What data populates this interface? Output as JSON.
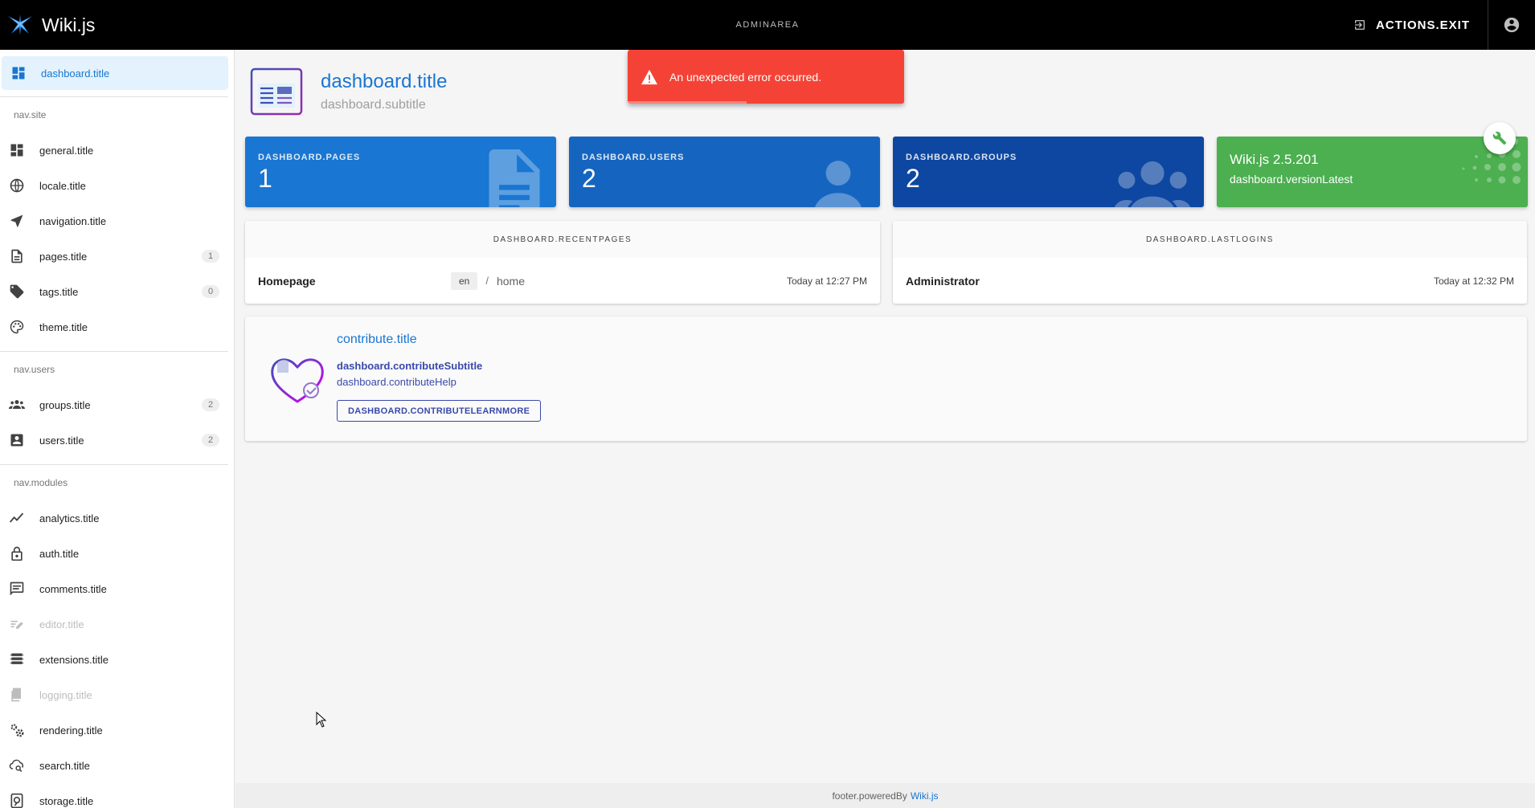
{
  "topbar": {
    "brand": "Wiki.js",
    "center_label": "ADMINAREA",
    "exit_label": "ACTIONS.EXIT"
  },
  "sidebar": {
    "dashboard": "dashboard.title",
    "site_header": "nav.site",
    "site_items": [
      {
        "label": "general.title",
        "icon": "dashboard-grid-icon"
      },
      {
        "label": "locale.title",
        "icon": "globe-icon"
      },
      {
        "label": "navigation.title",
        "icon": "navigation-arrow-icon"
      },
      {
        "label": "pages.title",
        "icon": "page-icon",
        "count": "1"
      },
      {
        "label": "tags.title",
        "icon": "tags-icon",
        "count": "0"
      },
      {
        "label": "theme.title",
        "icon": "palette-icon"
      }
    ],
    "users_header": "nav.users",
    "user_items": [
      {
        "label": "groups.title",
        "icon": "groups-icon",
        "count": "2"
      },
      {
        "label": "users.title",
        "icon": "user-card-icon",
        "count": "2"
      }
    ],
    "modules_header": "nav.modules",
    "module_items": [
      {
        "label": "analytics.title",
        "icon": "chart-line-icon"
      },
      {
        "label": "auth.title",
        "icon": "lock-icon"
      },
      {
        "label": "comments.title",
        "icon": "comment-icon"
      },
      {
        "label": "editor.title",
        "icon": "editor-icon",
        "disabled": true
      },
      {
        "label": "extensions.title",
        "icon": "extensions-icon"
      },
      {
        "label": "logging.title",
        "icon": "log-icon",
        "disabled": true
      },
      {
        "label": "rendering.title",
        "icon": "cogs-icon"
      },
      {
        "label": "search.title",
        "icon": "search-cloud-icon"
      },
      {
        "label": "storage.title",
        "icon": "storage-icon"
      }
    ]
  },
  "header": {
    "title": "dashboard.title",
    "subtitle": "dashboard.subtitle"
  },
  "stats": {
    "pages_label": "DASHBOARD.PAGES",
    "pages_value": "1",
    "users_label": "DASHBOARD.USERS",
    "users_value": "2",
    "groups_label": "DASHBOARD.GROUPS",
    "groups_value": "2",
    "version_title": "Wiki.js 2.5.201",
    "version_sub": "dashboard.versionLatest"
  },
  "recent_pages": {
    "heading": "DASHBOARD.RECENTPAGES",
    "rows": [
      {
        "title": "Homepage",
        "locale": "en",
        "path": "home",
        "time": "Today at 12:27 PM"
      }
    ]
  },
  "last_logins": {
    "heading": "DASHBOARD.LASTLOGINS",
    "rows": [
      {
        "name": "Administrator",
        "time": "Today at 12:32 PM"
      }
    ]
  },
  "contribute": {
    "title": "contribute.title",
    "subtitle": "dashboard.contributeSubtitle",
    "help": "dashboard.contributeHelp",
    "button": "DASHBOARD.CONTRIBUTELEARNMORE"
  },
  "footer": {
    "text": "footer.poweredBy",
    "link": "Wiki.js"
  },
  "toast": {
    "message": "An unexpected error occurred.",
    "progress": 0.43
  },
  "colors": {
    "accent": "#1976d2",
    "pages_card": "#1976d2",
    "users_card": "#1565c0",
    "groups_card": "#0d47a1",
    "version_card": "#4caf50",
    "error": "#f44336"
  }
}
